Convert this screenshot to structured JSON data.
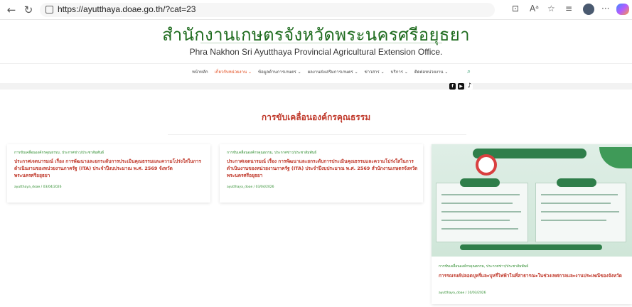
{
  "browser": {
    "url": "https://ayutthaya.doae.go.th/?cat=23",
    "back_icon": "back-arrow-icon",
    "reload_icon": "reload-icon",
    "font_label": "Aᵃ",
    "more_label": "···"
  },
  "site": {
    "title": "สำนักงานเกษตรจังหวัดพระนครศรีอยุธยา",
    "subtitle": "Phra Nakhon Sri Ayutthaya Provincial Agricultural Extension Office."
  },
  "nav": {
    "items": [
      {
        "label": "หน้าหลัก"
      },
      {
        "label": "เกี่ยวกับหน่วยงาน ⌄"
      },
      {
        "label": "ข้อมูลด้านการเกษตร ⌄"
      },
      {
        "label": "ผลงานส่งเสริมการเกษตร ⌄"
      },
      {
        "label": "ข่าวสาร ⌄"
      },
      {
        "label": "บริการ ⌄"
      },
      {
        "label": "ติดต่อหน่วยงาน ⌄"
      }
    ],
    "active_index": 1,
    "active_color": "#e24a1c"
  },
  "page": {
    "heading": "การขับเคลื่อนองค์กรคุณธรรม"
  },
  "posts": [
    {
      "category": "การขับเคลื่อนองค์กรคุณธรรม, ประกาศข่าว/ประชาสัมพันธ์",
      "title": "ประกาศเจตนารมณ์ เรื่อง การพัฒนาและยกระดับการประเมินคุณธรรมและความโปร่งใสในการดำเนินงานของหน่วยงานภาครัฐ (ITA) ประจำปีงบประมาณ พ.ศ. 2569 จังหวัดพระนครศรีอยุธยา",
      "meta": "ayutthaya_doae / 03/04/2026"
    },
    {
      "category": "การขับเคลื่อนองค์กรคุณธรรม, ประกาศข่าว/ประชาสัมพันธ์",
      "title": "ประกาศเจตนารมณ์ เรื่อง การพัฒนาและยกระดับการประเมินคุณธรรมและความโปร่งใสในการดำเนินงานของหน่วยงานภาครัฐ (ITA) ประจำปีงบประมาณ พ.ศ. 2569 สำนักงานเกษตรจังหวัดพระนครศรีอยุธยา",
      "meta": "ayutthaya_doae / 03/04/2026"
    },
    {
      "category": "การขับเคลื่อนองค์กรคุณธรรม, ประกาศข่าว/ประชาสัมพันธ์",
      "title": "การรณรงค์ปลอดบุหรี่และบุหรี่ไฟฟ้าในที่สาธารณะในช่วงเทศกาลและงานประเพณีของจังหวัด",
      "meta": "ayutthaya_doae / 10/03/2026"
    }
  ]
}
